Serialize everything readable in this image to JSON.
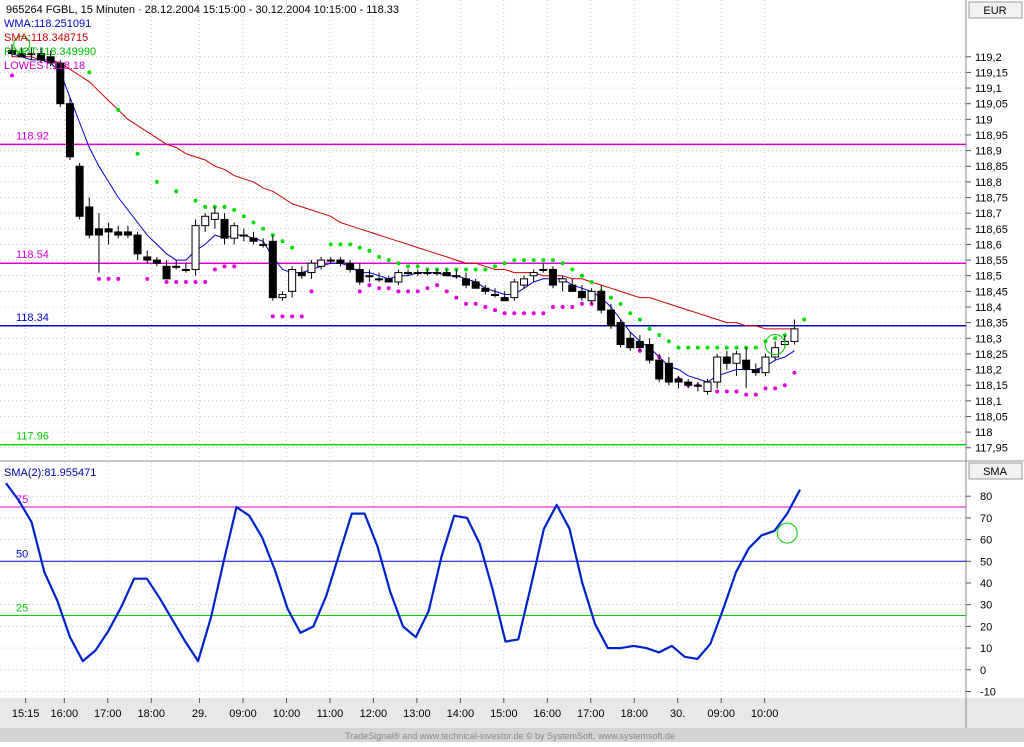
{
  "header": {
    "title": "965264  FGBL, 15 Minuten · 28.12.2004 15:15:00 - 30.12.2004 10:15:00 - 118.33",
    "currency": "EUR",
    "lower_axis_label": "SMA",
    "footer": "TradeSignal® and www.technical-investor.de © by SystemSoft, www.systemsoft.de"
  },
  "legend": {
    "wma": "WMA:118.251091",
    "sma": "SMA:118.348715",
    "pivot": "PIVOT:118.349990",
    "lowest": "LOWEST:118.18"
  },
  "lower_legend": "SMA(2):81.955471",
  "colors": {
    "wma": "#0000cc",
    "sma": "#cc0000",
    "sar_high": "#00dd00",
    "sar_low": "#dd00dd",
    "line_magenta": "#dd00dd",
    "line_blue": "#0000cc",
    "line_green": "#00cc00",
    "oscillator": "#0022cc"
  },
  "chart_data": [
    {
      "type": "candlestick",
      "ylim": [
        117.93,
        119.26
      ],
      "y_ticks": [
        "119,2",
        "119,15",
        "119,1",
        "119,05",
        "119",
        "118,95",
        "118,9",
        "118,85",
        "118,8",
        "118,75",
        "118,7",
        "118,65",
        "118,6",
        "118,55",
        "118,5",
        "118,45",
        "118,4",
        "118,35",
        "118,3",
        "118,25",
        "118,2",
        "118,15",
        "118,1",
        "118,05",
        "118",
        "117,95"
      ],
      "y_tick_values": [
        119.2,
        119.15,
        119.1,
        119.05,
        119,
        118.95,
        118.9,
        118.85,
        118.8,
        118.75,
        118.7,
        118.65,
        118.6,
        118.55,
        118.5,
        118.45,
        118.4,
        118.35,
        118.3,
        118.25,
        118.2,
        118.15,
        118.1,
        118.05,
        118,
        117.95
      ],
      "x_labels": [
        "15:15",
        "16:00",
        "17:00",
        "18:00",
        "29.",
        "09:00",
        "10:00",
        "11:00",
        "12:00",
        "13:00",
        "14:00",
        "15:00",
        "16:00",
        "17:00",
        "18:00",
        "30.",
        "09:00",
        "10:00"
      ],
      "x_label_bars": [
        1,
        5,
        9.5,
        14,
        19,
        23.5,
        28,
        32.5,
        37,
        41.5,
        46,
        50.5,
        55,
        59.5,
        64,
        68.5,
        73,
        77.5
      ],
      "candles": [
        [
          119.22,
          119.24,
          119.2,
          119.21
        ],
        [
          119.21,
          119.23,
          119.2,
          119.2
        ],
        [
          119.21,
          119.23,
          119.19,
          119.21
        ],
        [
          119.21,
          119.23,
          119.18,
          119.19
        ],
        [
          119.2,
          119.22,
          119.17,
          119.18
        ],
        [
          119.18,
          119.19,
          119.04,
          119.05
        ],
        [
          119.05,
          119.07,
          118.87,
          118.88
        ],
        [
          118.85,
          118.86,
          118.68,
          118.69
        ],
        [
          118.72,
          118.75,
          118.62,
          118.63
        ],
        [
          118.65,
          118.7,
          118.51,
          118.63
        ],
        [
          118.65,
          118.67,
          118.6,
          118.64
        ],
        [
          118.64,
          118.66,
          118.62,
          118.63
        ],
        [
          118.64,
          118.66,
          118.62,
          118.63
        ],
        [
          118.63,
          118.64,
          118.55,
          118.57
        ],
        [
          118.56,
          118.58,
          118.54,
          118.55
        ],
        [
          118.55,
          118.56,
          118.53,
          118.54
        ],
        [
          118.53,
          118.55,
          118.49,
          118.49
        ],
        [
          118.53,
          118.55,
          118.52,
          118.53
        ],
        [
          118.52,
          118.54,
          118.51,
          118.52
        ],
        [
          118.52,
          118.68,
          118.5,
          118.66
        ],
        [
          118.66,
          118.7,
          118.64,
          118.69
        ],
        [
          118.68,
          118.72,
          118.65,
          118.7
        ],
        [
          118.68,
          118.7,
          118.6,
          118.62
        ],
        [
          118.62,
          118.67,
          118.6,
          118.66
        ],
        [
          118.63,
          118.65,
          118.61,
          118.63
        ],
        [
          118.62,
          118.64,
          118.6,
          118.61
        ],
        [
          118.6,
          118.62,
          118.59,
          118.6
        ],
        [
          118.61,
          118.63,
          118.42,
          118.43
        ],
        [
          118.43,
          118.45,
          118.42,
          118.44
        ],
        [
          118.45,
          118.53,
          118.43,
          118.52
        ],
        [
          118.51,
          118.53,
          118.49,
          118.5
        ],
        [
          118.51,
          118.55,
          118.49,
          118.54
        ],
        [
          118.53,
          118.56,
          118.52,
          118.55
        ],
        [
          118.55,
          118.56,
          118.54,
          118.55
        ],
        [
          118.55,
          118.56,
          118.53,
          118.54
        ],
        [
          118.54,
          118.55,
          118.51,
          118.52
        ],
        [
          118.52,
          118.54,
          118.47,
          118.48
        ],
        [
          118.5,
          118.52,
          118.48,
          118.5
        ],
        [
          118.49,
          118.51,
          118.48,
          118.49
        ],
        [
          118.49,
          118.5,
          118.48,
          118.48
        ],
        [
          118.48,
          118.52,
          118.47,
          118.51
        ],
        [
          118.51,
          118.52,
          118.5,
          118.51
        ],
        [
          118.51,
          118.52,
          118.5,
          118.51
        ],
        [
          118.51,
          118.52,
          118.5,
          118.51
        ],
        [
          118.51,
          118.52,
          118.5,
          118.51
        ],
        [
          118.51,
          118.52,
          118.5,
          118.5
        ],
        [
          118.5,
          118.52,
          118.49,
          118.5
        ],
        [
          118.49,
          118.51,
          118.46,
          118.47
        ],
        [
          118.48,
          118.49,
          118.46,
          118.46
        ],
        [
          118.46,
          118.47,
          118.44,
          118.45
        ],
        [
          118.44,
          118.46,
          118.43,
          118.44
        ],
        [
          118.43,
          118.45,
          118.42,
          118.42
        ],
        [
          118.43,
          118.49,
          118.42,
          118.48
        ],
        [
          118.47,
          118.5,
          118.46,
          118.49
        ],
        [
          118.5,
          118.52,
          118.48,
          118.51
        ],
        [
          118.52,
          118.54,
          118.51,
          118.52
        ],
        [
          118.52,
          118.53,
          118.46,
          118.47
        ],
        [
          118.48,
          118.5,
          118.45,
          118.49
        ],
        [
          118.47,
          118.49,
          118.45,
          118.45
        ],
        [
          118.45,
          118.47,
          118.42,
          118.43
        ],
        [
          118.42,
          118.46,
          118.41,
          118.45
        ],
        [
          118.45,
          118.47,
          118.38,
          118.39
        ],
        [
          118.39,
          118.41,
          118.33,
          118.34
        ],
        [
          118.35,
          118.36,
          118.27,
          118.28
        ],
        [
          118.3,
          118.32,
          118.26,
          118.27
        ],
        [
          118.29,
          118.31,
          118.26,
          118.27
        ],
        [
          118.28,
          118.3,
          118.22,
          118.23
        ],
        [
          118.23,
          118.25,
          118.16,
          118.17
        ],
        [
          118.22,
          118.24,
          118.15,
          118.16
        ],
        [
          118.17,
          118.18,
          118.14,
          118.16
        ],
        [
          118.16,
          118.17,
          118.14,
          118.15
        ],
        [
          118.15,
          118.16,
          118.13,
          118.15
        ],
        [
          118.13,
          118.17,
          118.12,
          118.16
        ],
        [
          118.16,
          118.25,
          118.14,
          118.24
        ],
        [
          118.24,
          118.26,
          118.2,
          118.22
        ],
        [
          118.22,
          118.26,
          118.18,
          118.25
        ],
        [
          118.23,
          118.27,
          118.14,
          118.2
        ],
        [
          118.2,
          118.22,
          118.18,
          118.19
        ],
        [
          118.19,
          118.25,
          118.18,
          118.24
        ],
        [
          118.24,
          118.29,
          118.23,
          118.27
        ],
        [
          118.28,
          118.31,
          118.27,
          118.29
        ],
        [
          118.29,
          118.36,
          118.28,
          118.33
        ]
      ],
      "wma": [
        119.21,
        119.2,
        119.19,
        119.19,
        119.18,
        119.15,
        119.07,
        118.99,
        118.91,
        118.85,
        118.8,
        118.75,
        118.71,
        118.67,
        118.63,
        118.6,
        118.57,
        118.55,
        118.55,
        118.58,
        118.6,
        118.63,
        118.62,
        118.63,
        118.63,
        118.62,
        118.61,
        118.56,
        118.52,
        118.51,
        118.51,
        118.52,
        118.53,
        118.54,
        118.54,
        118.53,
        118.51,
        118.51,
        118.5,
        118.49,
        118.5,
        118.5,
        118.51,
        118.51,
        118.51,
        118.5,
        118.5,
        118.49,
        118.48,
        118.46,
        118.45,
        118.44,
        118.44,
        118.46,
        118.48,
        118.49,
        118.49,
        118.49,
        118.47,
        118.46,
        118.45,
        118.43,
        118.4,
        118.36,
        118.32,
        118.29,
        118.27,
        118.24,
        118.21,
        118.2,
        118.18,
        118.17,
        118.16,
        118.18,
        118.19,
        118.2,
        118.2,
        118.2,
        118.21,
        118.23,
        118.24,
        118.26
      ],
      "sma": [
        119.2,
        119.2,
        119.2,
        119.19,
        119.19,
        119.18,
        119.16,
        119.14,
        119.12,
        119.09,
        119.06,
        119.03,
        119.0,
        118.98,
        118.96,
        118.94,
        118.92,
        118.91,
        118.89,
        118.88,
        118.87,
        118.85,
        118.84,
        118.82,
        118.81,
        118.8,
        118.78,
        118.77,
        118.75,
        118.73,
        118.72,
        118.71,
        118.7,
        118.69,
        118.67,
        118.66,
        118.65,
        118.64,
        118.63,
        118.62,
        118.61,
        118.6,
        118.59,
        118.58,
        118.57,
        118.56,
        118.55,
        118.54,
        118.54,
        118.53,
        118.52,
        118.52,
        118.51,
        118.51,
        118.51,
        118.5,
        118.5,
        118.5,
        118.49,
        118.49,
        118.48,
        118.47,
        118.46,
        118.45,
        118.44,
        118.43,
        118.43,
        118.42,
        118.41,
        118.4,
        118.39,
        118.38,
        118.37,
        118.36,
        118.35,
        118.35,
        118.34,
        118.34,
        118.33,
        118.33,
        118.33,
        118.33
      ],
      "sar_high_bars": [
        8,
        11,
        13,
        15,
        17,
        19,
        20,
        21,
        22,
        23,
        24,
        25,
        26,
        27,
        28,
        29,
        33,
        34,
        35,
        36,
        37,
        38,
        39,
        40,
        41,
        42,
        43,
        44,
        45,
        46,
        47,
        48,
        49,
        50,
        51,
        52,
        53,
        54,
        55,
        56,
        57,
        58,
        59,
        60,
        61,
        62,
        63,
        64,
        65,
        66,
        67,
        68,
        69,
        70,
        71,
        72,
        73,
        74,
        75,
        76,
        77,
        78,
        79,
        80,
        81,
        82
      ],
      "sar_high_values": [
        119.15,
        119.03,
        118.89,
        118.8,
        118.77,
        118.74,
        118.72,
        118.72,
        118.72,
        118.71,
        118.69,
        118.67,
        118.65,
        118.63,
        118.61,
        118.59,
        118.6,
        118.6,
        118.6,
        118.59,
        118.58,
        118.56,
        118.55,
        118.54,
        118.53,
        118.53,
        118.52,
        118.52,
        118.52,
        118.52,
        118.52,
        118.52,
        118.52,
        118.53,
        118.54,
        118.55,
        118.55,
        118.55,
        118.55,
        118.55,
        118.54,
        118.52,
        118.5,
        118.48,
        118.45,
        118.43,
        118.41,
        118.38,
        118.36,
        118.33,
        118.31,
        118.29,
        118.27,
        118.27,
        118.27,
        118.27,
        118.27,
        118.27,
        118.27,
        118.27,
        118.27,
        118.29,
        118.3,
        118.31,
        118.32,
        118.36
      ],
      "sar_low_bars": [
        0,
        5,
        6,
        9,
        10,
        11,
        14,
        16,
        17,
        18,
        19,
        20,
        21,
        22,
        23,
        27,
        28,
        29,
        30,
        31,
        36,
        37,
        38,
        39,
        40,
        41,
        42,
        43,
        44,
        45,
        46,
        47,
        48,
        49,
        50,
        51,
        52,
        53,
        54,
        55,
        56,
        57,
        58,
        59,
        60,
        61,
        62,
        63,
        64,
        65,
        66,
        67,
        68,
        69,
        70,
        71,
        72,
        73,
        74,
        75,
        76,
        77,
        78,
        79,
        80,
        81
      ],
      "sar_low_values": [
        119.14,
        119.15,
        118.98,
        118.49,
        118.49,
        118.49,
        118.49,
        118.48,
        118.48,
        118.48,
        118.48,
        118.48,
        118.52,
        118.53,
        118.53,
        118.37,
        118.37,
        118.37,
        118.37,
        118.45,
        118.45,
        118.47,
        118.46,
        118.46,
        118.45,
        118.45,
        118.45,
        118.46,
        118.47,
        118.45,
        118.43,
        118.41,
        118.41,
        118.4,
        118.39,
        118.38,
        118.38,
        118.38,
        118.38,
        118.38,
        118.4,
        118.4,
        118.4,
        118.41,
        118.41,
        118.41,
        118.37,
        118.31,
        118.28,
        118.26,
        118.26,
        118.24,
        118.21,
        118.17,
        118.15,
        118.15,
        118.14,
        118.13,
        118.13,
        118.13,
        118.12,
        118.12,
        118.14,
        118.14,
        118.15,
        118.19
      ],
      "hlines": [
        {
          "label": "118.92",
          "value": 118.92,
          "color": "line_magenta"
        },
        {
          "label": "118.54",
          "value": 118.54,
          "color": "line_magenta"
        },
        {
          "label": "118.34",
          "value": 118.34,
          "color": "line_blue"
        },
        {
          "label": "117.96",
          "value": 117.96,
          "color": "line_green"
        }
      ],
      "marker_circle": {
        "bar": 79,
        "value": 118.28
      },
      "marker_circle_top": {
        "bar": 1,
        "value": 119.24
      }
    },
    {
      "type": "line",
      "name": "SMA(2)",
      "ylim": [
        -13,
        93
      ],
      "y_ticks": [
        80,
        70,
        60,
        50,
        40,
        30,
        20,
        10,
        0,
        -10
      ],
      "hlines": [
        {
          "label": "75",
          "value": 75,
          "color": "line_magenta"
        },
        {
          "label": "50",
          "value": 50,
          "color": "line_blue"
        },
        {
          "label": "25",
          "value": 25,
          "color": "line_green"
        }
      ],
      "values": [
        86,
        78,
        68,
        45,
        32,
        15,
        4,
        9,
        18,
        29,
        42,
        42,
        33,
        23,
        13,
        4,
        24,
        50,
        75,
        71,
        61,
        46,
        28,
        17,
        20,
        34,
        53,
        72,
        72,
        57,
        36,
        20,
        15,
        27,
        52,
        71,
        70,
        58,
        37,
        13,
        14,
        39,
        65,
        76,
        65,
        40,
        21,
        10,
        10,
        11,
        10,
        8,
        11,
        6,
        5,
        12,
        28,
        45,
        56,
        62,
        64,
        72,
        83
      ],
      "circle": {
        "index": 61,
        "value": 63
      }
    }
  ]
}
